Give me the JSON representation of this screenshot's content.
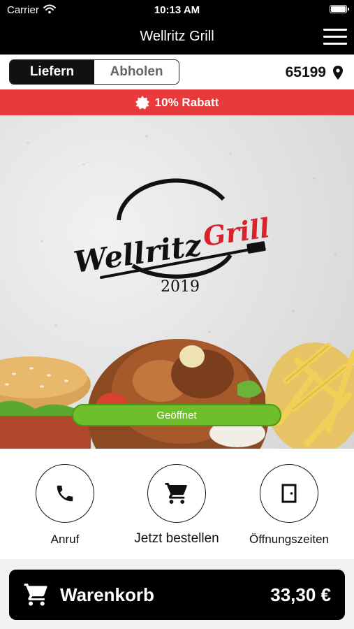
{
  "status_bar": {
    "carrier": "Carrier",
    "time": "10:13 AM"
  },
  "header": {
    "title": "Wellritz Grill",
    "menu_icon": "hamburger-menu-icon"
  },
  "delivery_toggle": {
    "options": [
      "Liefern",
      "Abholen"
    ],
    "selected": "Liefern"
  },
  "location": {
    "zip": "65199",
    "icon": "location-pin-icon"
  },
  "promo": {
    "label": "10% Rabatt",
    "icon": "discount-badge-icon"
  },
  "hero": {
    "logo": {
      "name_part1": "Wellritz",
      "name_part2": "Grill",
      "year": "2019"
    },
    "status": "Geöffnet"
  },
  "actions": [
    {
      "label": "Anruf",
      "icon": "phone-icon"
    },
    {
      "label": "Jetzt bestellen",
      "icon": "shopping-cart-icon"
    },
    {
      "label": "Öffnungszeiten",
      "icon": "door-icon"
    }
  ],
  "cart": {
    "label": "Warenkorb",
    "total": "33,30 €",
    "icon": "shopping-cart-icon"
  },
  "colors": {
    "accent_red": "#e8393b",
    "open_green": "#6fbf2c",
    "logo_red": "#d9222a",
    "dark": "#000000"
  }
}
